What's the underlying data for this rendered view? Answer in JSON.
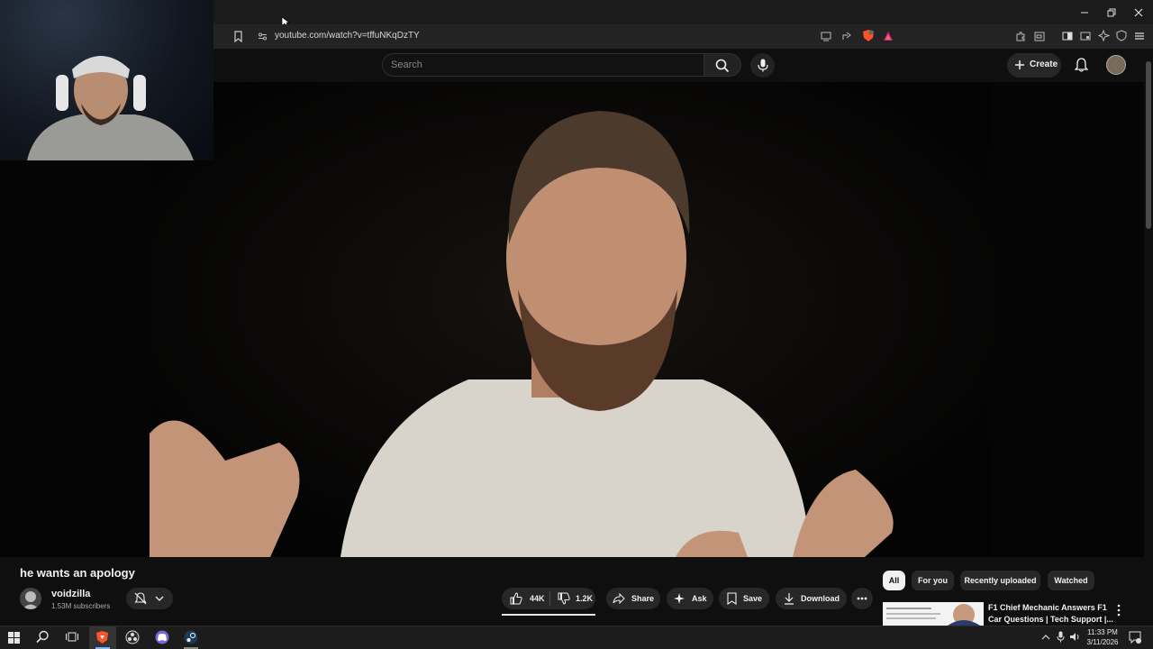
{
  "browser": {
    "url": "youtube.com/watch?v=tffuNKqDzTY",
    "window_controls": [
      "minimize",
      "restore",
      "close"
    ]
  },
  "header": {
    "search_placeholder": "Search",
    "create_label": "Create"
  },
  "video": {
    "title": "he wants an apology"
  },
  "channel": {
    "name": "voidzilla",
    "subscribers": "1.53M subscribers"
  },
  "actions": {
    "likes": "44K",
    "dislikes": "1.2K",
    "share": "Share",
    "ask": "Ask",
    "save": "Save",
    "download": "Download"
  },
  "chips": [
    "All",
    "For you",
    "Recently uploaded",
    "Watched"
  ],
  "recommendation": {
    "title_line1": "F1 Chief Mechanic Answers F1",
    "title_line2": "Car Questions | Tech Support |..."
  },
  "taskbar": {
    "time": "11:33 PM",
    "date": "3/11/2026"
  },
  "colors": {
    "background": "#0f0f0f",
    "pill": "#272727",
    "brave_orange": "#fb542b"
  }
}
